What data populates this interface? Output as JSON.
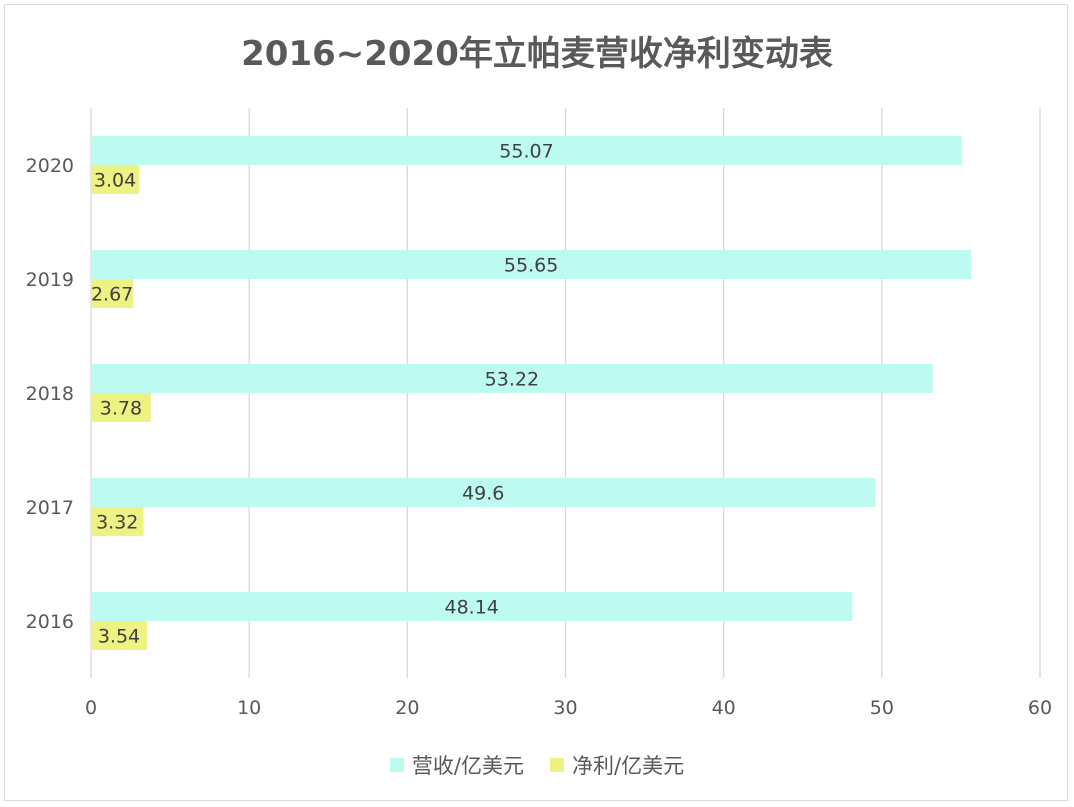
{
  "chart_data": {
    "type": "bar",
    "orientation": "horizontal",
    "title": "2016~2020年立帕麦营收净利变动表",
    "categories": [
      "2016",
      "2017",
      "2018",
      "2019",
      "2020"
    ],
    "series": [
      {
        "name": "营收/亿美元",
        "color": "#bdfbf0",
        "values": [
          48.14,
          49.6,
          53.22,
          55.65,
          55.07
        ]
      },
      {
        "name": "净利/亿美元",
        "color": "#eef282",
        "values": [
          3.54,
          3.32,
          3.78,
          2.67,
          3.04
        ]
      }
    ],
    "xlim": [
      0,
      60
    ],
    "xticks": [
      0,
      10,
      20,
      30,
      40,
      50,
      60
    ],
    "grid": true,
    "legend": "bottom",
    "data_labels": true
  },
  "colors": {
    "grid": "#d9d9d9",
    "text": "#595959",
    "label": "#404040"
  }
}
